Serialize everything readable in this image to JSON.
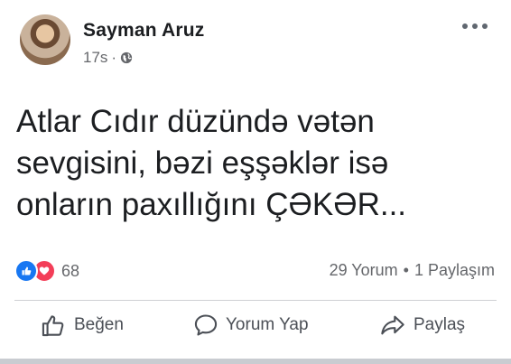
{
  "post": {
    "author": "Sayman Aruz",
    "time": "17s",
    "separator": "·",
    "privacy_icon": "globe-icon",
    "more_icon": "more-options-icon",
    "text_lines": [
      "Atlar Cıdır düzündə vətən",
      "sevgisini, bəzi eşşəklər isə",
      "onların paxıllığını ÇƏKƏR..."
    ]
  },
  "stats": {
    "reactions": [
      "like-icon",
      "love-icon"
    ],
    "reaction_count": "68",
    "comments": "29 Yorum",
    "bullet": "•",
    "shares": "1 Paylaşım"
  },
  "actions": {
    "like_label": "Beğen",
    "comment_label": "Yorum Yap",
    "share_label": "Paylaş"
  },
  "colors": {
    "like_blue": "#1877f2",
    "love_red": "#f33e58",
    "secondary_text": "#65676b"
  }
}
